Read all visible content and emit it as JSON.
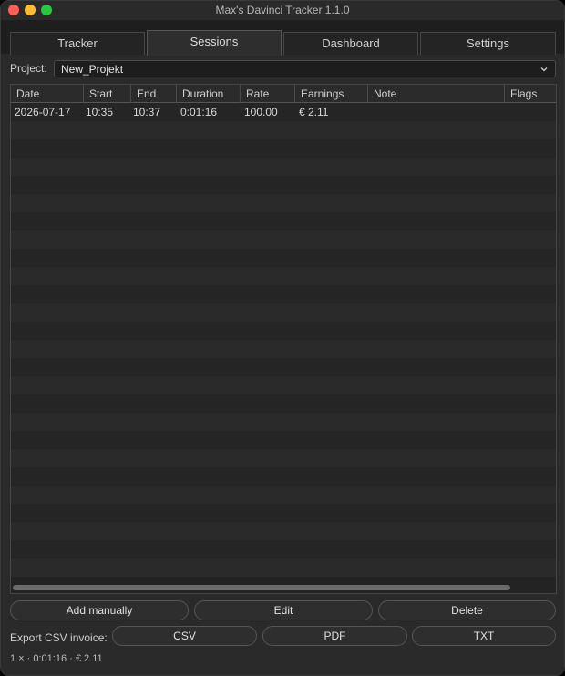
{
  "window": {
    "title": "Max's Davinci Tracker 1.1.0"
  },
  "tabs": [
    {
      "label": "Tracker"
    },
    {
      "label": "Sessions"
    },
    {
      "label": "Dashboard"
    },
    {
      "label": "Settings"
    }
  ],
  "active_tab": "Sessions",
  "project": {
    "label": "Project:",
    "selected": "New_Projekt"
  },
  "table": {
    "columns": [
      "Date",
      "Start",
      "End",
      "Duration",
      "Rate",
      "Earnings",
      "Note",
      "Flags"
    ],
    "rows": [
      {
        "date": "2026-07-17",
        "start": "10:35",
        "end": "10:37",
        "duration": "0:01:16",
        "rate": "100.00",
        "earnings": "€ 2.11",
        "note": "",
        "flags": ""
      }
    ]
  },
  "buttons": {
    "add": "Add manually",
    "edit": "Edit",
    "delete": "Delete"
  },
  "export": {
    "label": "Export CSV invoice:",
    "csv": "CSV",
    "pdf": "PDF",
    "txt": "TXT"
  },
  "status": {
    "summary": "1 × · 0:01:16 · € 2.11"
  },
  "colors": {
    "close": "#ff5f57",
    "minimize": "#febc2e",
    "maximize": "#28c840"
  }
}
